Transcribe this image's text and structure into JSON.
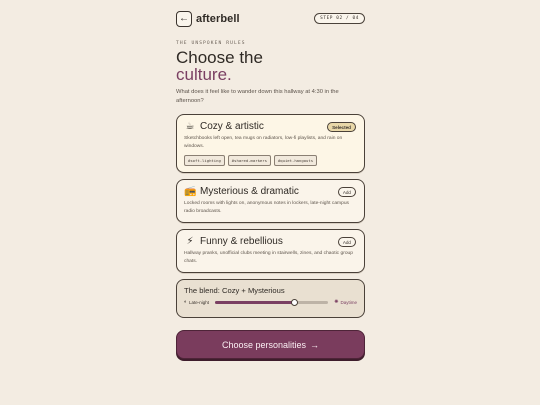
{
  "header": {
    "back_icon": "arrow-left-icon",
    "back_glyph": "←",
    "brand": "afterbell",
    "step": "STEP 02 / 04"
  },
  "intro": {
    "eyebrow": "THE UNSPOKEN RULES",
    "title_line1": "Choose the",
    "title_line2": "culture.",
    "lede": "What does it feel like to wander down this hallway at 4:30 in the afternoon?"
  },
  "options": [
    {
      "icon": "coffee-cup-icon",
      "glyph": "☕",
      "title": "Cozy & artistic",
      "badge": "Selected",
      "selected": true,
      "description": "Sketchbooks left open, tea mugs on radiators, low-fi playlists, and rain on windows.",
      "tags": [
        "#soft-lighting",
        "#shared-markers",
        "#quiet-hangouts"
      ]
    },
    {
      "icon": "radio-icon",
      "glyph": "📻",
      "title": "Mysterious & dramatic",
      "badge": "Add",
      "selected": false,
      "description": "Locked rooms with lights on, anonymous notes in lockers, late-night campus radio broadcasts.",
      "tags": []
    },
    {
      "icon": "lightning-icon",
      "glyph": "⚡",
      "title": "Funny & rebellious",
      "badge": "Add",
      "selected": false,
      "description": "Hallway pranks, unofficial clubs meeting in stairwells, zines, and chaotic group chats.",
      "tags": []
    }
  ],
  "blend": {
    "title": "The blend: Cozy + Mysterious",
    "left_label": "Late-night",
    "left_icon": "moon-icon",
    "left_glyph": "◐",
    "right_label": "Daytime",
    "right_icon": "sun-icon",
    "right_glyph": "✺",
    "value": 0.7
  },
  "cta": {
    "label": "Choose personalities",
    "icon": "arrow-right-icon",
    "glyph": "→"
  },
  "colors": {
    "background": "#f3ece2",
    "accent": "#7a3f62",
    "selected_badge": "#e9d8a8"
  }
}
